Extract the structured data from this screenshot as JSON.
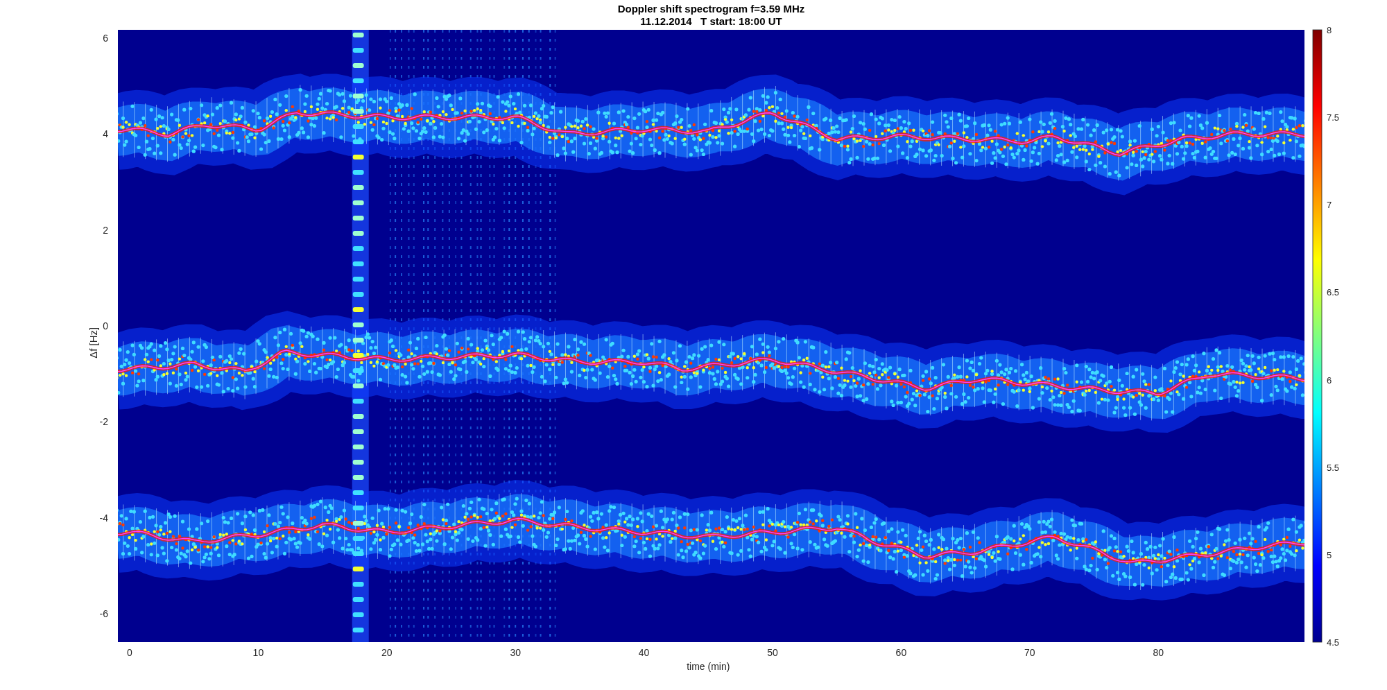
{
  "figure": {
    "title_lines": [
      "Doppler shift spectrogram f=3.59 MHz",
      "11.12.2014   T start: 18:00 UT"
    ],
    "x_axis": {
      "label": "time (min)",
      "ticks": [
        "0",
        "10",
        "20",
        "30",
        "40",
        "50",
        "60",
        "70",
        "80"
      ]
    },
    "y_axis": {
      "label": "Δf [Hz]",
      "ticks": [
        "6",
        "4",
        "2",
        "0",
        "-2",
        "-4",
        "-6"
      ]
    },
    "colorbar": {
      "ticks": [
        "8",
        "7.5",
        "7",
        "6.5",
        "6",
        "5.5",
        "5",
        "4.5"
      ]
    }
  }
}
